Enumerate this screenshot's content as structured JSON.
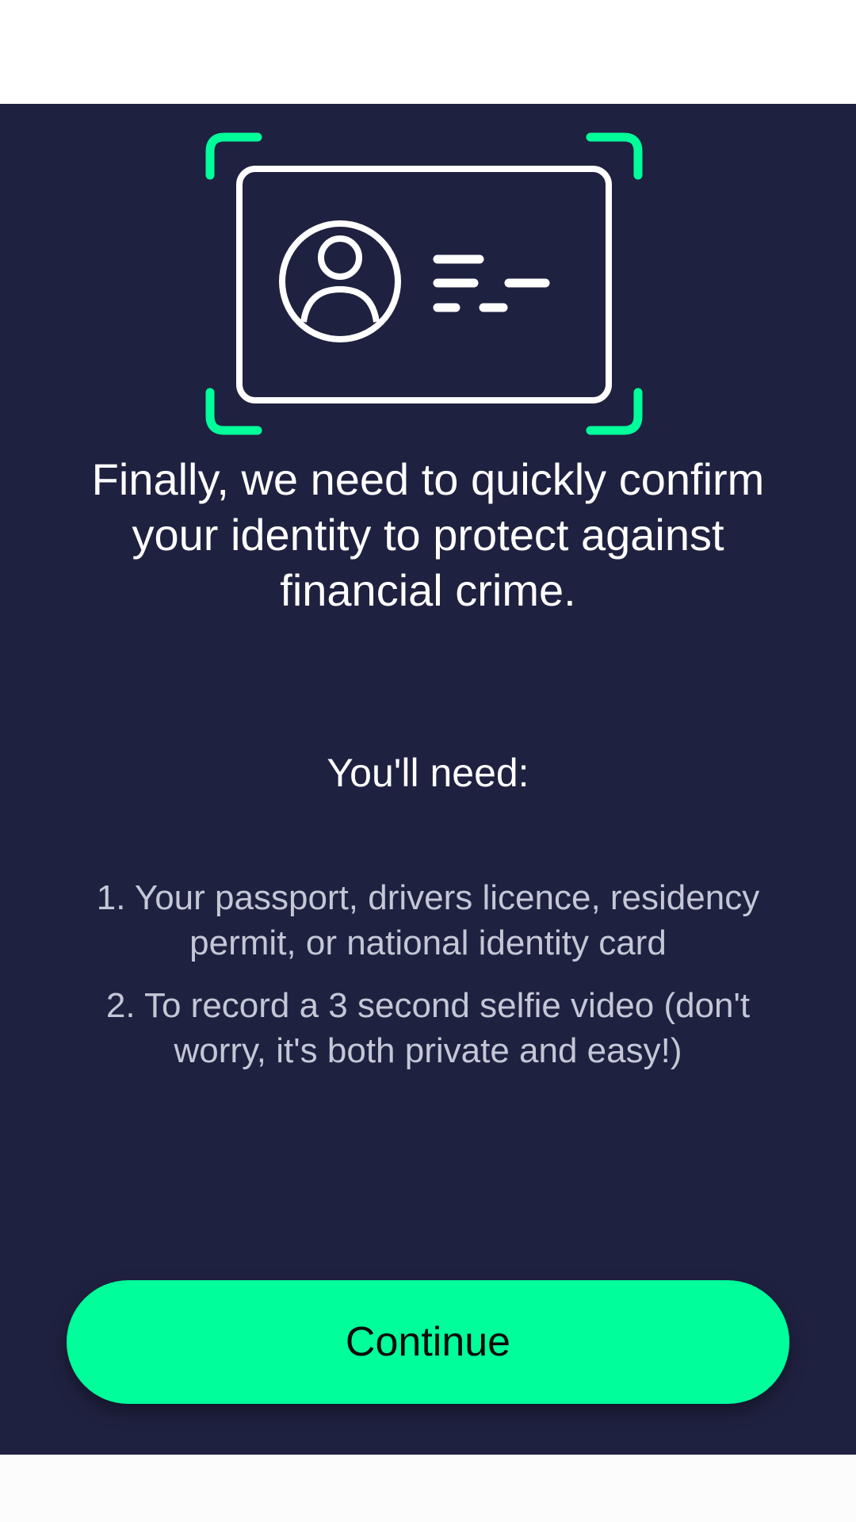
{
  "illustration": {
    "icon": "id-card-scan-icon",
    "accent_color": "#00fe9b",
    "line_color": "#ffffff"
  },
  "colors": {
    "background": "#1f2140",
    "button": "#00fe9b"
  },
  "headline": "Finally, we need to quickly confirm your identity to protect against financial crime.",
  "needs_heading": "You'll need:",
  "requirements": [
    "1. Your passport, drivers licence, residency permit, or national identity card",
    "2. To record a 3 second selfie video (don't worry, it's both private and easy!)"
  ],
  "continue_label": "Continue"
}
